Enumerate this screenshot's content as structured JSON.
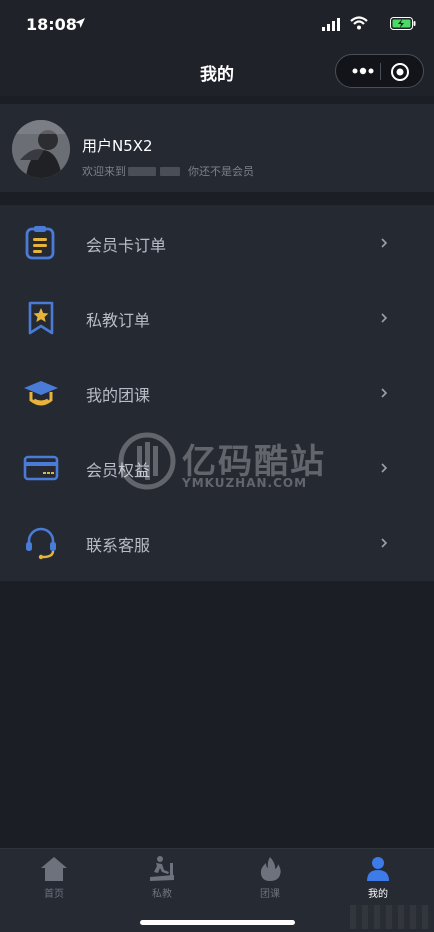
{
  "status_bar": {
    "time": "18:08"
  },
  "nav": {
    "title": "我的"
  },
  "profile": {
    "username": "用户N5X2",
    "welcome_prefix": "欢迎来到",
    "welcome_suffix": "你还不是会员"
  },
  "menu": {
    "items": [
      {
        "label": "会员卡订单",
        "icon": "clipboard-icon"
      },
      {
        "label": "私教订单",
        "icon": "star-bookmark-icon"
      },
      {
        "label": "我的团课",
        "icon": "graduation-cap-icon"
      },
      {
        "label": "会员权益",
        "icon": "card-icon"
      },
      {
        "label": "联系客服",
        "icon": "headset-icon"
      }
    ]
  },
  "watermark": {
    "title": "亿码酷站",
    "subtitle": "YMKUZHAN.COM"
  },
  "tabbar": {
    "tabs": [
      {
        "label": "首页",
        "icon": "home-icon"
      },
      {
        "label": "私教",
        "icon": "treadmill-icon"
      },
      {
        "label": "团课",
        "icon": "flame-icon"
      },
      {
        "label": "我的",
        "icon": "user-icon"
      }
    ],
    "active_index": 3
  },
  "colors": {
    "background": "#1b1e25",
    "card": "#252932",
    "icon_blue": "#4a7bd6",
    "icon_yellow": "#e8b33a",
    "active_tab": "#3d7be8"
  }
}
